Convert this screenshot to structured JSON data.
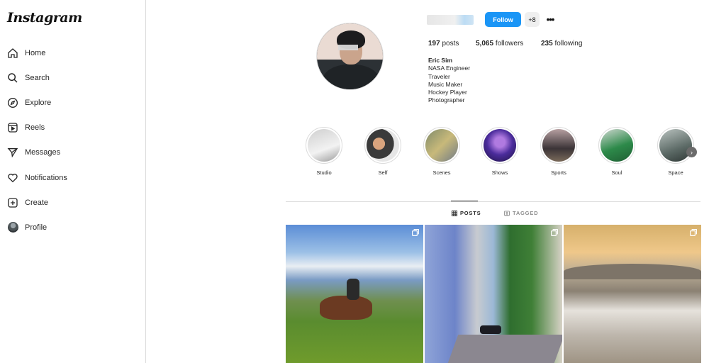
{
  "sidebar": {
    "logo": "Instagram",
    "items": [
      {
        "label": "Home",
        "icon": "home-icon"
      },
      {
        "label": "Search",
        "icon": "search-icon"
      },
      {
        "label": "Explore",
        "icon": "compass-icon"
      },
      {
        "label": "Reels",
        "icon": "reels-icon"
      },
      {
        "label": "Messages",
        "icon": "send-icon"
      },
      {
        "label": "Notifications",
        "icon": "heart-icon"
      },
      {
        "label": "Create",
        "icon": "plus-square-icon"
      },
      {
        "label": "Profile",
        "icon": "avatar-icon"
      }
    ]
  },
  "profile": {
    "follow_label": "Follow",
    "add_user_label": "+8",
    "more_label": "•••",
    "stats": {
      "posts_count": "197",
      "posts_label": "posts",
      "followers_count": "5,065",
      "followers_label": "followers",
      "following_count": "235",
      "following_label": "following"
    },
    "bio": {
      "name": "Eric Sim",
      "lines": [
        "NASA Engineer",
        "Traveler",
        "Music Maker",
        "Hockey Player",
        "Photographer"
      ]
    }
  },
  "highlights": [
    {
      "label": "Studio",
      "color_a": "#b9b9b9",
      "color_b": "#e8e8e8"
    },
    {
      "label": "Self",
      "color_a": "#3a3a3a",
      "color_b": "#d9a47e"
    },
    {
      "label": "Scenes",
      "color_a": "#7f8a6a",
      "color_b": "#c8b97a"
    },
    {
      "label": "Shows",
      "color_a": "#4b2c9c",
      "color_b": "#b07ae0"
    },
    {
      "label": "Sports",
      "color_a": "#3b3437",
      "color_b": "#b7a0a2"
    },
    {
      "label": "Soul",
      "color_a": "#2d8a4a",
      "color_b": "#cfd8d1"
    },
    {
      "label": "Space",
      "color_a": "#5c6a66",
      "color_b": "#b9c2bf"
    }
  ],
  "tabs": {
    "posts_label": "POSTS",
    "tagged_label": "TAGGED"
  }
}
